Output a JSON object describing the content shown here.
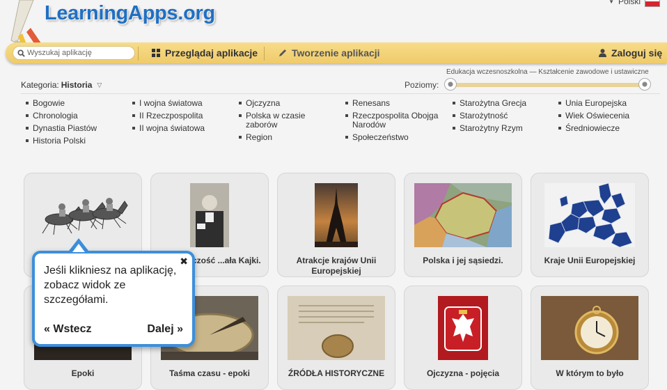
{
  "site": {
    "logo_text": "LearningApps.org",
    "language": "Polski"
  },
  "nav": {
    "search_placeholder": "Wyszukaj aplikację",
    "browse": "Przeglądaj aplikacje",
    "create": "Tworzenie aplikacji",
    "login": "Zaloguj się"
  },
  "filters": {
    "category_label": "Kategoria:",
    "category_value": "Historia",
    "levels_label": "Poziomy:",
    "levels_range": "Edukacja wczesnoszkolna — Kształcenie zawodowe i ustawiczne"
  },
  "categories": [
    [
      "Bogowie",
      "Chronologia",
      "Dynastia Piastów",
      "Historia Polski"
    ],
    [
      "I wojna światowa",
      "II Rzeczpospolita",
      "II wojna światowa"
    ],
    [
      "Ojczyzna",
      "Polska w czasie zaborów",
      "Region"
    ],
    [
      "Renesans",
      "Rzeczpospolita Obojga Narodów",
      "Społeczeństwo"
    ],
    [
      "Starożytna Grecja",
      "Starożytność",
      "Starożytny Rzym"
    ],
    [
      "Unia Europejska",
      "Wiek Oświecenia",
      "Średniowiecze"
    ]
  ],
  "apps": [
    {
      "title": "",
      "image": "horse-race"
    },
    {
      "title": "...ie twórczość ...ała Kajki.",
      "image": "portrait-photo"
    },
    {
      "title": "Atrakcje krajów Unii Europejskiej",
      "image": "eiffel-tower"
    },
    {
      "title": "Polska i jej sąsiedzi.",
      "image": "poland-map"
    },
    {
      "title": "Kraje Unii Europejskiej",
      "image": "eu-map"
    },
    {
      "title": "Epoki",
      "image": "dark-photo"
    },
    {
      "title": "Taśma czasu - epoki",
      "image": "sundial"
    },
    {
      "title": "ŹRÓDŁA HISTORYCZNE",
      "image": "historic-document"
    },
    {
      "title": "Ojczyzna - pojęcia",
      "image": "polish-emblem"
    },
    {
      "title": "W którym to było",
      "image": "pocket-watch"
    }
  ],
  "tooltip": {
    "text": "Jeśli klikniesz na aplikację, zobacz widok ze szczegółami.",
    "back": "« Wstecz",
    "next": "Dalej »",
    "close": "✖"
  },
  "colors": {
    "brand_blue": "#1f6fc4",
    "nav_yellow": "#f2d37a",
    "tooltip_border": "#3c8fdc"
  }
}
